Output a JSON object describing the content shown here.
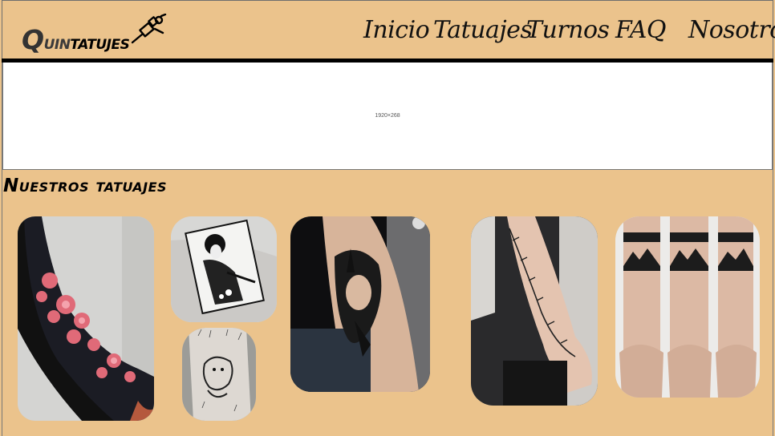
{
  "brand": {
    "logo_big": "Q",
    "logo_part1": "uin",
    "logo_part2": "tatujes",
    "logo_icon": "tattoo-machine-icon"
  },
  "nav": {
    "items": [
      {
        "label": "Inicio"
      },
      {
        "label": "Tatuajes"
      },
      {
        "label": "Turnos"
      },
      {
        "label": "FAQ"
      },
      {
        "label": "Nosotros"
      }
    ]
  },
  "banner": {
    "placeholder": "1920×268"
  },
  "gallery": {
    "title": "Nuestros tatuajes"
  },
  "colors": {
    "background": "#ebc38c",
    "banner": "#ffffff",
    "rule": "#000000"
  }
}
